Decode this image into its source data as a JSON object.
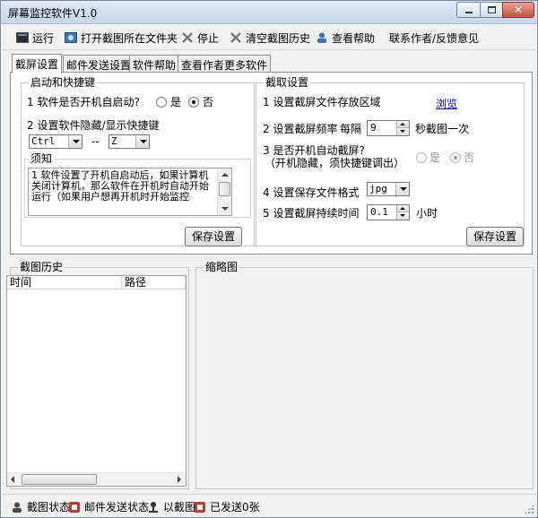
{
  "window": {
    "title": "屏幕监控软件V1.0"
  },
  "toolbar": {
    "run": "运行",
    "open_folder": "打开截图所在文件夹",
    "stop": "停止",
    "clear_history": "清空截图历史",
    "help": "查看帮助",
    "contact": "联系作者/反馈意见"
  },
  "tabs": [
    "截屏设置",
    "邮件发送设置",
    "软件帮助",
    "查看作者更多软件"
  ],
  "startup_group": {
    "title": "启动和快捷键",
    "autostart_q": "1 软件是否开机自启动?",
    "yes": "是",
    "no": "否",
    "selected": "否",
    "hotkey_label": "2 设置软件隐藏/显示快捷键",
    "hotkey_mod": "Ctrl",
    "hotkey_sep": "--",
    "hotkey_key": "Z",
    "notice_title": "须知",
    "notice_text": "1 软件设置了开机自启动后，如果计算机关闭计算机，那么软件在开机时自动开始运行（如果用户想再开机时开始监控",
    "save": "保存设置"
  },
  "capture_group": {
    "title": "截取设置",
    "area_label": "1 设置截屏文件存放区域",
    "browse": "浏览",
    "freq_label": "2 设置截屏频率",
    "every": "每隔",
    "freq_value": "9",
    "freq_suffix": "秒截图一次",
    "auto_q": "3 是否开机自动截屏?",
    "auto_note": "（开机隐藏，须快捷键调出）",
    "yes": "是",
    "no": "否",
    "auto_selected": "否",
    "format_label": "4 设置保存文件格式",
    "format_value": "jpg",
    "duration_label": "5 设置截屏持续时间",
    "duration_value": "0.1",
    "duration_unit": "小时",
    "save": "保存设置"
  },
  "history": {
    "title": "截图历史",
    "columns": [
      "时间",
      "路径"
    ]
  },
  "thumbnail": {
    "title": "缩略图"
  },
  "status": {
    "capture": "截图状态",
    "mail": "邮件发送状态",
    "captured": "以截图",
    "sent": "已发送0张"
  }
}
